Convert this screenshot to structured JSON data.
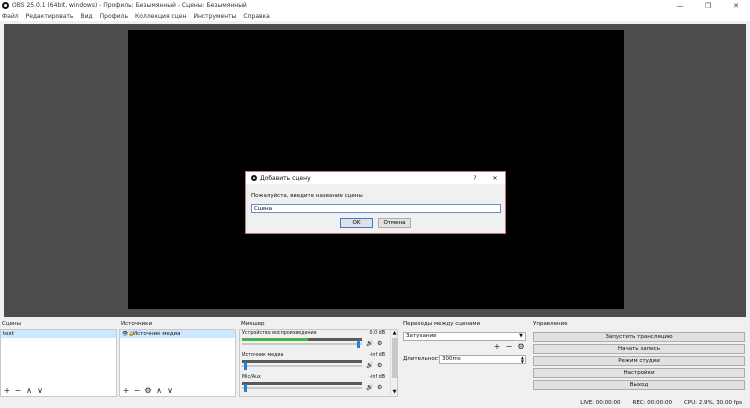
{
  "window": {
    "title": "OBS 25.0.1 (64bit, windows) - Профиль: Безымянный - Сцены: Безымянный",
    "minimize": "—",
    "maximize": "❐",
    "close": "✕"
  },
  "menu": [
    "Файл",
    "Редактировать",
    "Вид",
    "Профиль",
    "Коллекция сцен",
    "Инструменты",
    "Справка"
  ],
  "dialog": {
    "title": "Добавить сцену",
    "help": "?",
    "close": "✕",
    "prompt": "Пожалуйста, введите название сцены",
    "value": "Сцена",
    "ok": "OK",
    "cancel": "Отмена"
  },
  "scenes": {
    "title": "Сцены",
    "items": [
      "text"
    ],
    "tools": {
      "add": "+",
      "remove": "−",
      "up": "∧",
      "down": "∨"
    }
  },
  "sources": {
    "title": "Источники",
    "items": [
      "Источник медиа"
    ],
    "tools": {
      "add": "+",
      "remove": "−",
      "settings": "⚙",
      "up": "∧",
      "down": "∨"
    }
  },
  "mixer": {
    "title": "Микшер",
    "channels": [
      {
        "name": "Устройство воспроизведения",
        "db": "0.0 dB",
        "level": 0.55,
        "volume": 0.98
      },
      {
        "name": "Источник медиа",
        "db": "-inf dB",
        "level": 0,
        "volume": 0.02
      },
      {
        "name": "Mic/Aux",
        "db": "-inf dB",
        "level": 0,
        "volume": 0.02
      }
    ]
  },
  "transitions": {
    "title": "Переходы между сценами",
    "selected": "Затухание",
    "duration_label": "Длительность",
    "duration_value": "300ms",
    "tools": {
      "add": "+",
      "remove": "−",
      "settings": "⚙"
    }
  },
  "controls": {
    "title": "Управление",
    "buttons": [
      "Запустить трансляцию",
      "Начать запись",
      "Режим студии",
      "Настройки",
      "Выход"
    ]
  },
  "status": {
    "live": "LIVE: 00:00:00",
    "rec": "REC: 00:00:00",
    "cpu": "CPU: 2.9%, 30.00 fps"
  }
}
